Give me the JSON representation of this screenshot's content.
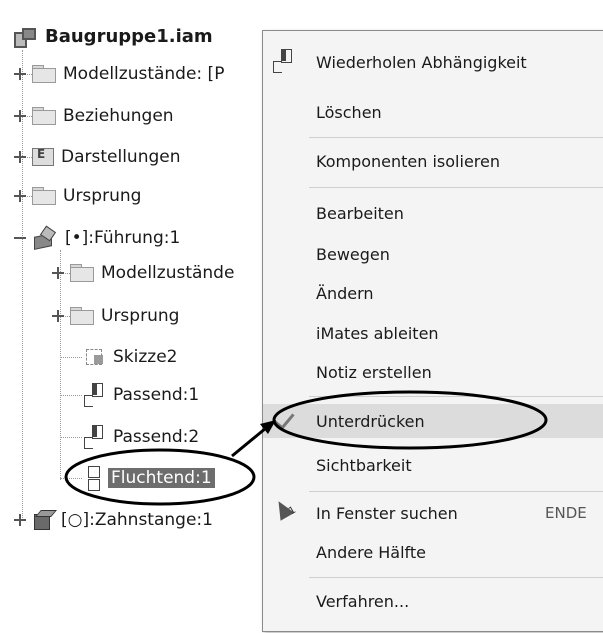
{
  "tree": {
    "root": "Baugruppe1.iam",
    "items": [
      {
        "label": "Modellzustände: [P"
      },
      {
        "label": "Beziehungen"
      },
      {
        "label": "Darstellungen"
      },
      {
        "label": "Ursprung"
      },
      {
        "label": "[•]:Führung:1"
      },
      {
        "label": "Modellzustände"
      },
      {
        "label": "Ursprung"
      },
      {
        "label": "Skizze2"
      },
      {
        "label": "Passend:1"
      },
      {
        "label": "Passend:2"
      },
      {
        "label": "Fluchtend:1"
      },
      {
        "label": "[○]:Zahnstange:1"
      }
    ]
  },
  "context_menu": {
    "items": [
      {
        "label": "Wiederholen Abhängigkeit"
      },
      {
        "label": "Löschen"
      },
      {
        "label": "Komponenten isolieren"
      },
      {
        "label": "Bearbeiten"
      },
      {
        "label": "Bewegen"
      },
      {
        "label": "Ändern"
      },
      {
        "label": "iMates ableiten"
      },
      {
        "label": "Notiz erstellen"
      },
      {
        "label": "Unterdrücken"
      },
      {
        "label": "Sichtbarkeit"
      },
      {
        "label": "In Fenster suchen",
        "shortcut": "ENDE"
      },
      {
        "label": "Andere Hälfte"
      },
      {
        "label": "Verfahren..."
      }
    ]
  }
}
